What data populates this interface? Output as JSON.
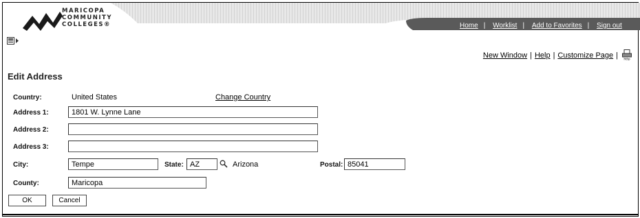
{
  "brand": {
    "line1": "MARICOPA",
    "line2": "COMMUNITY",
    "line3": "COLLEGES®"
  },
  "header_nav": {
    "home": "Home",
    "worklist": "Worklist",
    "add_favorites": "Add to Favorites",
    "sign_out": "Sign out"
  },
  "top_links": {
    "new_window": "New Window",
    "help": "Help",
    "customize": "Customize Page",
    "separator": "|"
  },
  "page": {
    "title": "Edit Address"
  },
  "form": {
    "country_label": "Country:",
    "country_value": "United States",
    "change_country": "Change Country",
    "address1_label": "Address 1:",
    "address1_value": "1801 W. Lynne Lane",
    "address2_label": "Address 2:",
    "address2_value": "",
    "address3_label": "Address 3:",
    "address3_value": "",
    "city_label": "City:",
    "city_value": "Tempe",
    "state_label": "State:",
    "state_value": "AZ",
    "state_name": "Arizona",
    "postal_label": "Postal:",
    "postal_value": "85041",
    "county_label": "County:",
    "county_value": "Maricopa"
  },
  "buttons": {
    "ok": "OK",
    "cancel": "Cancel"
  },
  "colors": {
    "header_band": "#5a5a5a",
    "header_light": "#d4d4d4"
  }
}
